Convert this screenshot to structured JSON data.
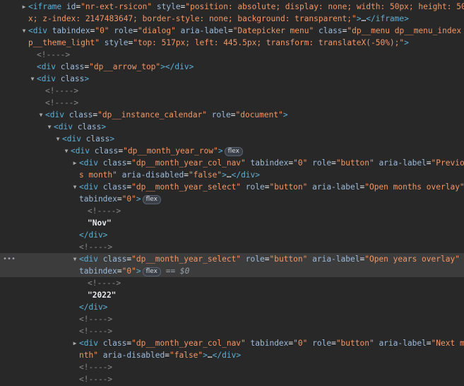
{
  "rows": [
    {
      "indent": 0,
      "tri": "right",
      "segs": [
        {
          "c": "tg",
          "t": "<iframe"
        },
        {
          "c": "an",
          "t": " id"
        },
        {
          "c": "pu",
          "t": "="
        },
        {
          "c": "av",
          "t": "\"nr-ext-rsicon\""
        },
        {
          "c": "an",
          "t": " style"
        },
        {
          "c": "pu",
          "t": "="
        },
        {
          "c": "av",
          "t": "\"position: absolute; display: none; width: 50px; height: 50p"
        }
      ]
    },
    {
      "indent": 0,
      "cont": true,
      "segs": [
        {
          "c": "av",
          "t": "x; z-index: 2147483647; border-style: none; background: transparent;\""
        },
        {
          "c": "tg",
          "t": ">"
        },
        {
          "c": "tx",
          "t": "…"
        },
        {
          "c": "tg",
          "t": "</iframe>"
        }
      ]
    },
    {
      "indent": 0,
      "tri": "down",
      "segs": [
        {
          "c": "tg",
          "t": "<div"
        },
        {
          "c": "an",
          "t": " tabindex"
        },
        {
          "c": "pu",
          "t": "="
        },
        {
          "c": "av",
          "t": "\"0\""
        },
        {
          "c": "an",
          "t": " role"
        },
        {
          "c": "pu",
          "t": "="
        },
        {
          "c": "av",
          "t": "\"dialog\""
        },
        {
          "c": "an",
          "t": " aria-label"
        },
        {
          "c": "pu",
          "t": "="
        },
        {
          "c": "av",
          "t": "\"Datepicker menu\""
        },
        {
          "c": "an",
          "t": " class"
        },
        {
          "c": "pu",
          "t": "="
        },
        {
          "c": "av",
          "t": "\"dp__menu dp__menu_index d"
        }
      ]
    },
    {
      "indent": 0,
      "cont": true,
      "segs": [
        {
          "c": "av",
          "t": "p__theme_light\""
        },
        {
          "c": "an",
          "t": " style"
        },
        {
          "c": "pu",
          "t": "="
        },
        {
          "c": "av",
          "t": "\"top: 517px; left: 445.5px; transform: translateX(-50%);\""
        },
        {
          "c": "tg",
          "t": ">"
        }
      ]
    },
    {
      "indent": 1,
      "segs": [
        {
          "c": "cm",
          "t": "<!---->"
        }
      ]
    },
    {
      "indent": 1,
      "segs": [
        {
          "c": "tg",
          "t": "<div"
        },
        {
          "c": "an",
          "t": " class"
        },
        {
          "c": "pu",
          "t": "="
        },
        {
          "c": "av",
          "t": "\"dp__arrow_top\""
        },
        {
          "c": "tg",
          "t": "></div>"
        }
      ]
    },
    {
      "indent": 1,
      "tri": "down",
      "segs": [
        {
          "c": "tg",
          "t": "<div"
        },
        {
          "c": "an",
          "t": " class"
        },
        {
          "c": "tg",
          "t": ">"
        }
      ]
    },
    {
      "indent": 2,
      "segs": [
        {
          "c": "cm",
          "t": "<!---->"
        }
      ]
    },
    {
      "indent": 2,
      "segs": [
        {
          "c": "cm",
          "t": "<!---->"
        }
      ]
    },
    {
      "indent": 2,
      "tri": "down",
      "segs": [
        {
          "c": "tg",
          "t": "<div"
        },
        {
          "c": "an",
          "t": " class"
        },
        {
          "c": "pu",
          "t": "="
        },
        {
          "c": "av",
          "t": "\"dp__instance_calendar\""
        },
        {
          "c": "an",
          "t": " role"
        },
        {
          "c": "pu",
          "t": "="
        },
        {
          "c": "av",
          "t": "\"document\""
        },
        {
          "c": "tg",
          "t": ">"
        }
      ]
    },
    {
      "indent": 3,
      "tri": "down",
      "segs": [
        {
          "c": "tg",
          "t": "<div"
        },
        {
          "c": "an",
          "t": " class"
        },
        {
          "c": "tg",
          "t": ">"
        }
      ]
    },
    {
      "indent": 4,
      "tri": "down",
      "segs": [
        {
          "c": "tg",
          "t": "<div"
        },
        {
          "c": "an",
          "t": " class"
        },
        {
          "c": "tg",
          "t": ">"
        }
      ]
    },
    {
      "indent": 5,
      "tri": "down",
      "badge": "flex",
      "segs": [
        {
          "c": "tg",
          "t": "<div"
        },
        {
          "c": "an",
          "t": " class"
        },
        {
          "c": "pu",
          "t": "="
        },
        {
          "c": "av",
          "t": "\"dp__month_year_row\""
        },
        {
          "c": "tg",
          "t": ">"
        }
      ]
    },
    {
      "indent": 6,
      "tri": "right",
      "segs": [
        {
          "c": "tg",
          "t": "<div"
        },
        {
          "c": "an",
          "t": " class"
        },
        {
          "c": "pu",
          "t": "="
        },
        {
          "c": "av",
          "t": "\"dp__month_year_col_nav\""
        },
        {
          "c": "an",
          "t": " tabindex"
        },
        {
          "c": "pu",
          "t": "="
        },
        {
          "c": "av",
          "t": "\"0\""
        },
        {
          "c": "an",
          "t": " role"
        },
        {
          "c": "pu",
          "t": "="
        },
        {
          "c": "av",
          "t": "\"button\""
        },
        {
          "c": "an",
          "t": " aria-label"
        },
        {
          "c": "pu",
          "t": "="
        },
        {
          "c": "av",
          "t": "\"Previou"
        }
      ]
    },
    {
      "indent": 6,
      "cont": true,
      "segs": [
        {
          "c": "av",
          "t": "s month\""
        },
        {
          "c": "an",
          "t": " aria-disabled"
        },
        {
          "c": "pu",
          "t": "="
        },
        {
          "c": "av",
          "t": "\"false\""
        },
        {
          "c": "tg",
          "t": ">"
        },
        {
          "c": "tx",
          "t": "…"
        },
        {
          "c": "tg",
          "t": "</div>"
        }
      ]
    },
    {
      "indent": 6,
      "tri": "down",
      "segs": [
        {
          "c": "tg",
          "t": "<div"
        },
        {
          "c": "an",
          "t": " class"
        },
        {
          "c": "pu",
          "t": "="
        },
        {
          "c": "av",
          "t": "\"dp__month_year_select\""
        },
        {
          "c": "an",
          "t": " role"
        },
        {
          "c": "pu",
          "t": "="
        },
        {
          "c": "av",
          "t": "\"button\""
        },
        {
          "c": "an",
          "t": " aria-label"
        },
        {
          "c": "pu",
          "t": "="
        },
        {
          "c": "av",
          "t": "\"Open months overlay\""
        }
      ]
    },
    {
      "indent": 6,
      "cont": true,
      "badge": "flex",
      "segs": [
        {
          "c": "an",
          "t": "tabindex"
        },
        {
          "c": "pu",
          "t": "="
        },
        {
          "c": "av",
          "t": "\"0\""
        },
        {
          "c": "tg",
          "t": ">"
        }
      ]
    },
    {
      "indent": 7,
      "segs": [
        {
          "c": "cm",
          "t": "<!---->"
        }
      ]
    },
    {
      "indent": 7,
      "segs": [
        {
          "c": "tx bold",
          "t": "\"Nov\""
        }
      ]
    },
    {
      "indent": 6,
      "segs": [
        {
          "c": "tg",
          "t": "</div>"
        }
      ]
    },
    {
      "indent": 6,
      "segs": [
        {
          "c": "cm",
          "t": "<!---->"
        }
      ]
    },
    {
      "indent": 6,
      "tri": "down",
      "selected": true,
      "dots": true,
      "segs": [
        {
          "c": "tg",
          "t": "<div"
        },
        {
          "c": "an",
          "t": " class"
        },
        {
          "c": "pu",
          "t": "="
        },
        {
          "c": "av",
          "t": "\"dp__month_year_select\""
        },
        {
          "c": "an",
          "t": " role"
        },
        {
          "c": "pu",
          "t": "="
        },
        {
          "c": "av",
          "t": "\"button\""
        },
        {
          "c": "an",
          "t": " aria-label"
        },
        {
          "c": "pu",
          "t": "="
        },
        {
          "c": "av",
          "t": "\"Open years overlay\""
        }
      ]
    },
    {
      "indent": 6,
      "cont": true,
      "selected": true,
      "badge": "flex",
      "eq": "== $0",
      "segs": [
        {
          "c": "an",
          "t": "tabindex"
        },
        {
          "c": "pu",
          "t": "="
        },
        {
          "c": "av",
          "t": "\"0\""
        },
        {
          "c": "tg",
          "t": ">"
        }
      ]
    },
    {
      "indent": 7,
      "segs": [
        {
          "c": "cm",
          "t": "<!---->"
        }
      ]
    },
    {
      "indent": 7,
      "segs": [
        {
          "c": "tx bold",
          "t": "\"2022\""
        }
      ]
    },
    {
      "indent": 6,
      "segs": [
        {
          "c": "tg",
          "t": "</div>"
        }
      ]
    },
    {
      "indent": 6,
      "segs": [
        {
          "c": "cm",
          "t": "<!---->"
        }
      ]
    },
    {
      "indent": 6,
      "segs": [
        {
          "c": "cm",
          "t": "<!---->"
        }
      ]
    },
    {
      "indent": 6,
      "tri": "right",
      "segs": [
        {
          "c": "tg",
          "t": "<div"
        },
        {
          "c": "an",
          "t": " class"
        },
        {
          "c": "pu",
          "t": "="
        },
        {
          "c": "av",
          "t": "\"dp__month_year_col_nav\""
        },
        {
          "c": "an",
          "t": " tabindex"
        },
        {
          "c": "pu",
          "t": "="
        },
        {
          "c": "av",
          "t": "\"0\""
        },
        {
          "c": "an",
          "t": " role"
        },
        {
          "c": "pu",
          "t": "="
        },
        {
          "c": "av",
          "t": "\"button\""
        },
        {
          "c": "an",
          "t": " aria-label"
        },
        {
          "c": "pu",
          "t": "="
        },
        {
          "c": "av",
          "t": "\"Next mo"
        }
      ]
    },
    {
      "indent": 6,
      "cont": true,
      "segs": [
        {
          "c": "av",
          "t": "nth\""
        },
        {
          "c": "an",
          "t": " aria-disabled"
        },
        {
          "c": "pu",
          "t": "="
        },
        {
          "c": "av",
          "t": "\"false\""
        },
        {
          "c": "tg",
          "t": ">"
        },
        {
          "c": "tx",
          "t": "…"
        },
        {
          "c": "tg",
          "t": "</div>"
        }
      ]
    },
    {
      "indent": 6,
      "segs": [
        {
          "c": "cm",
          "t": "<!---->"
        }
      ]
    },
    {
      "indent": 6,
      "segs": [
        {
          "c": "cm",
          "t": "<!---->"
        }
      ]
    }
  ]
}
